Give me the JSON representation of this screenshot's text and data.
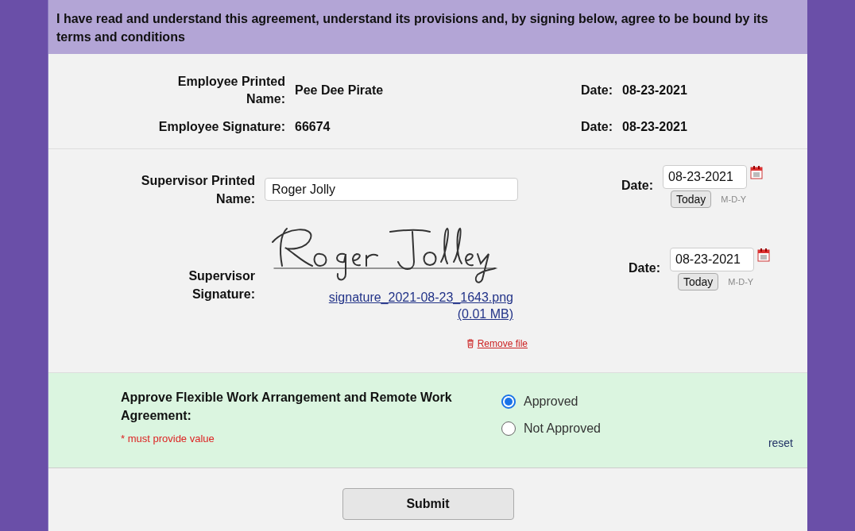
{
  "agreement_text": "I have read and understand this agreement, understand its provisions and, by signing below, agree to be bound by its terms and conditions",
  "employee": {
    "name_label": "Employee Printed Name:",
    "name_value": "Pee Dee Pirate",
    "name_date_label": "Date:",
    "name_date": "08-23-2021",
    "signature_label": "Employee Signature:",
    "signature_value": "66674",
    "signature_date_label": "Date:",
    "signature_date": "08-23-2021"
  },
  "supervisor": {
    "name_label": "Supervisor Printed Name:",
    "name_value": "Roger Jolly",
    "name_date_label": "Date:",
    "name_date": "08-23-2021",
    "signature_label": "Supervisor Signature:",
    "signature_file": "signature_2021-08-23_1643.png",
    "signature_size": "(0.01 MB)",
    "remove_file": "Remove file",
    "signature_date_label": "Date:",
    "signature_date": "08-23-2021",
    "name_today_button": "Today",
    "name_date_format": "M-D-Y",
    "signature_today_button": "Today",
    "signature_date_format": "M-D-Y"
  },
  "approval": {
    "label": "Approve Flexible Work Arrangement and Remote Work Agreement:",
    "required_note": "* must provide value",
    "options": [
      {
        "label": "Approved",
        "selected": true
      },
      {
        "label": "Not Approved",
        "selected": false
      }
    ],
    "reset": "reset"
  },
  "submit": "Submit"
}
